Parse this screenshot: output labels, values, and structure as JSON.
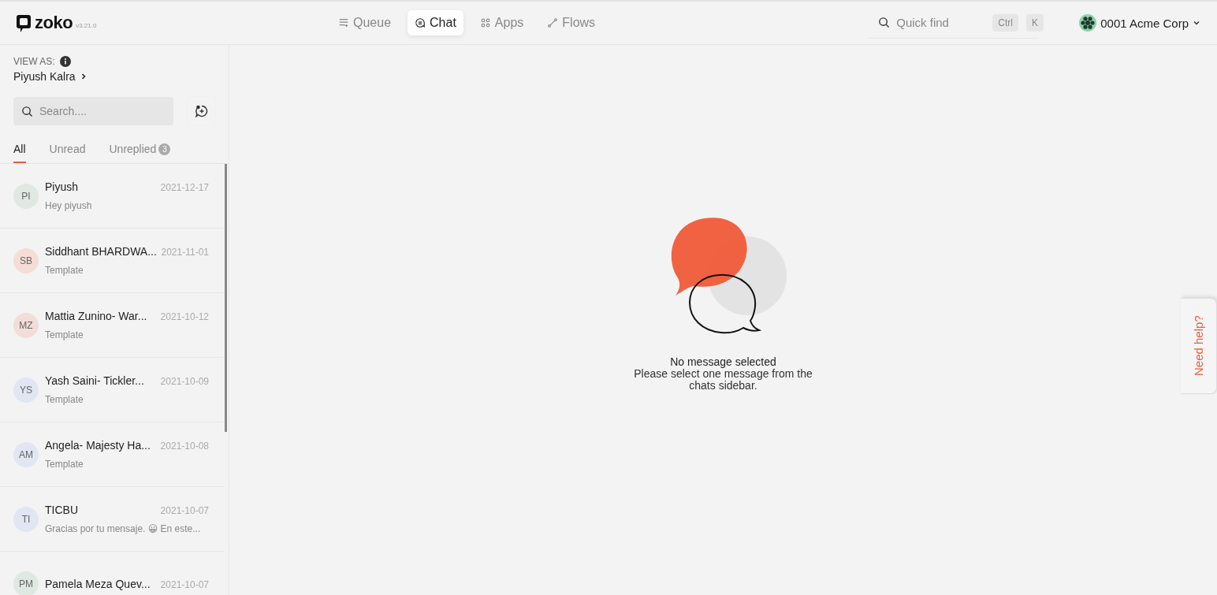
{
  "header": {
    "logo": "zoko",
    "version": "v3.21.0",
    "nav": [
      {
        "label": "Queue",
        "kind": "queue",
        "selected": false
      },
      {
        "label": "Chat",
        "kind": "chat",
        "selected": true
      },
      {
        "label": "Apps",
        "kind": "apps",
        "selected": false
      },
      {
        "label": "Flows",
        "kind": "flows",
        "selected": false
      }
    ],
    "quick_find": {
      "placeholder": "Quick find",
      "keys": [
        "Ctrl",
        "K"
      ]
    },
    "account": "0001 Acme Corp"
  },
  "sidebar": {
    "view_as_label": "VIEW AS:",
    "view_as_user": "Piyush Kalra",
    "search": {
      "placeholder": "Search...."
    },
    "filters": [
      {
        "label": "All",
        "selected": true
      },
      {
        "label": "Unread",
        "selected": false
      },
      {
        "label": "Unreplied",
        "count": "3",
        "selected": false
      }
    ],
    "chats": [
      {
        "initials": "PI",
        "color": "#dfe9e2",
        "name": "Piyush",
        "date": "2021-12-17",
        "preview": "Hey piyush"
      },
      {
        "initials": "SB",
        "color": "#f5ddd6",
        "name": "Siddhant BHARDWA...",
        "date": "2021-11-01",
        "preview": "Template"
      },
      {
        "initials": "MZ",
        "color": "#f3ddd8",
        "name": "Mattia Zunino- War...",
        "date": "2021-10-12",
        "preview": "Template"
      },
      {
        "initials": "YS",
        "color": "#e0e6f3",
        "name": "Yash Saini- Tickler...",
        "date": "2021-10-09",
        "preview": "Template"
      },
      {
        "initials": "AM",
        "color": "#e0e6f3",
        "name": "Angela- Majesty Ha...",
        "date": "2021-10-08",
        "preview": "Template"
      },
      {
        "initials": "TI",
        "color": "#e0e6f3",
        "name": "TICBU",
        "date": "2021-10-07",
        "preview": "Gracias por tu mensaje. 😀 En este..."
      },
      {
        "initials": "PM",
        "color": "#dfe9e2",
        "name": "Pamela Meza Quev...",
        "date": "2021-10-07"
      }
    ]
  },
  "empty_state": {
    "title": "No message selected",
    "message": "Please select one message from the chats sidebar."
  },
  "help_tab": "Need help?"
}
